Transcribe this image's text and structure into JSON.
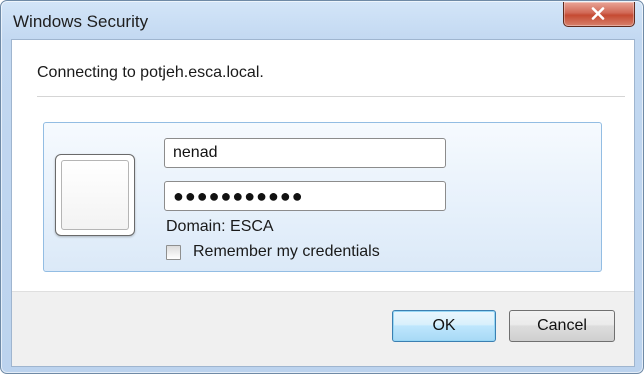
{
  "window": {
    "title": "Windows Security",
    "close_icon": "close-icon"
  },
  "dialog": {
    "connecting_text": "Connecting to potjeh.esca.local.",
    "credential_tile": {
      "avatar_icon": "user-tile-icon",
      "username_value": "nenad",
      "password_mask": "●●●●●●●●●●●",
      "domain_text": "Domain: ESCA",
      "remember_label": "Remember my credentials",
      "remember_checked": false
    }
  },
  "buttons": {
    "ok_label": "OK",
    "cancel_label": "Cancel"
  },
  "colors": {
    "tile_border": "#93bde3",
    "close_button": "#c54a32",
    "default_button_border": "#3c7fb1"
  }
}
